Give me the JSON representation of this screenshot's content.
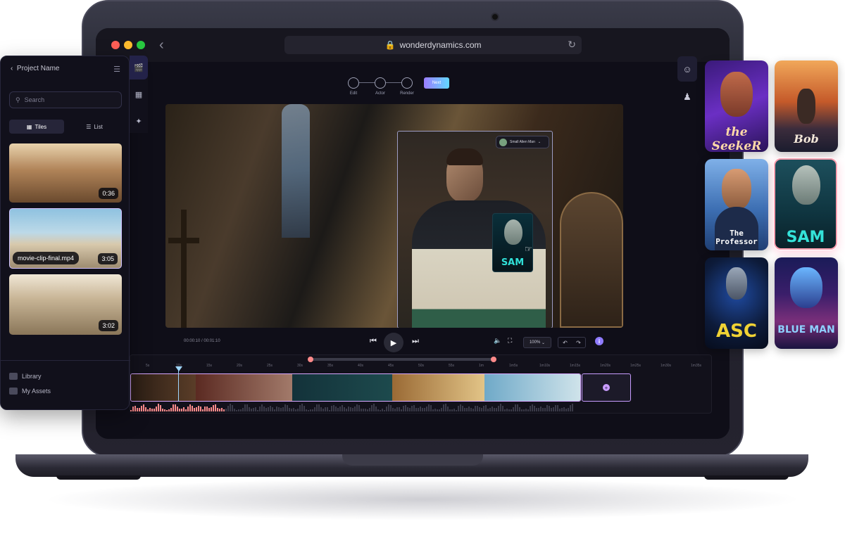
{
  "browser": {
    "url": "wonderdynamics.com",
    "lock_icon": "lock-icon",
    "reload_icon": "reload-icon",
    "back_icon": "back-arrow-icon"
  },
  "left_panel": {
    "project_name": "Project Name",
    "search_placeholder": "Search",
    "view_tabs": [
      {
        "label": "Tiles",
        "selected": true
      },
      {
        "label": "List",
        "selected": false
      }
    ],
    "clips": [
      {
        "duration": "0:36",
        "filename": ""
      },
      {
        "duration": "3:05",
        "filename": "movie-clip-final.mp4"
      },
      {
        "duration": "3:02",
        "filename": ""
      }
    ],
    "nav": [
      {
        "label": "Library",
        "icon": "library-icon"
      },
      {
        "label": "My Assets",
        "icon": "play-icon"
      }
    ]
  },
  "steps": [
    {
      "label": "Edit"
    },
    {
      "label": "Actor"
    },
    {
      "label": "Render"
    }
  ],
  "next_label": "Next",
  "actor_tag": "Small Alien Man",
  "mini_card_label": "SAM",
  "player": {
    "current": "00:00:10",
    "total": "00:01:10",
    "zoom": "100%",
    "info": "i"
  },
  "timeline": {
    "ticks": [
      "5s",
      "10s",
      "15s",
      "20s",
      "25s",
      "30s",
      "35s",
      "40s",
      "45s",
      "50s",
      "55s",
      "1m",
      "1m5s",
      "1m10s",
      "1m15s",
      "1m20s",
      "1m25s",
      "1m30s",
      "1m35s"
    ]
  },
  "characters": [
    {
      "title": "the SeekeR",
      "bg": "#5a2bb0"
    },
    {
      "title": "Bob",
      "bg": "#d06a2a"
    },
    {
      "title": "The Professor",
      "bg": "#3d6fb3"
    },
    {
      "title": "SAM",
      "bg": "#0f3540",
      "selected": true
    },
    {
      "title": "ASC",
      "bg": "#0d1b3a"
    },
    {
      "title": "BLUE MAN",
      "bg": "#3a1e6a"
    }
  ],
  "colors": {
    "accent": "#8f7bff",
    "clip_border": "#d7a7ff",
    "selected_card": "#ff9fb0"
  }
}
